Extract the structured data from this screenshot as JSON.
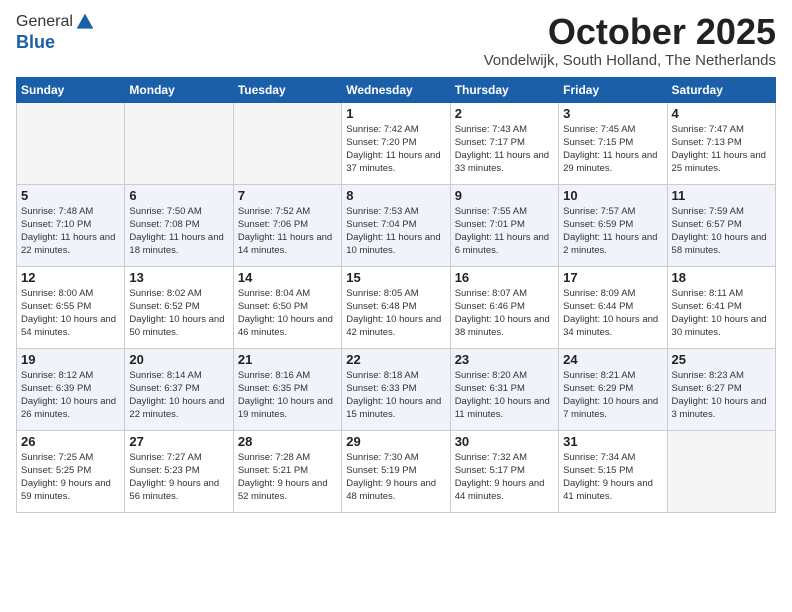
{
  "logo": {
    "general": "General",
    "blue": "Blue"
  },
  "header": {
    "month": "October 2025",
    "location": "Vondelwijk, South Holland, The Netherlands"
  },
  "weekdays": [
    "Sunday",
    "Monday",
    "Tuesday",
    "Wednesday",
    "Thursday",
    "Friday",
    "Saturday"
  ],
  "weeks": [
    [
      {
        "day": "",
        "sunrise": "",
        "sunset": "",
        "daylight": ""
      },
      {
        "day": "",
        "sunrise": "",
        "sunset": "",
        "daylight": ""
      },
      {
        "day": "",
        "sunrise": "",
        "sunset": "",
        "daylight": ""
      },
      {
        "day": "1",
        "sunrise": "Sunrise: 7:42 AM",
        "sunset": "Sunset: 7:20 PM",
        "daylight": "Daylight: 11 hours and 37 minutes."
      },
      {
        "day": "2",
        "sunrise": "Sunrise: 7:43 AM",
        "sunset": "Sunset: 7:17 PM",
        "daylight": "Daylight: 11 hours and 33 minutes."
      },
      {
        "day": "3",
        "sunrise": "Sunrise: 7:45 AM",
        "sunset": "Sunset: 7:15 PM",
        "daylight": "Daylight: 11 hours and 29 minutes."
      },
      {
        "day": "4",
        "sunrise": "Sunrise: 7:47 AM",
        "sunset": "Sunset: 7:13 PM",
        "daylight": "Daylight: 11 hours and 25 minutes."
      }
    ],
    [
      {
        "day": "5",
        "sunrise": "Sunrise: 7:48 AM",
        "sunset": "Sunset: 7:10 PM",
        "daylight": "Daylight: 11 hours and 22 minutes."
      },
      {
        "day": "6",
        "sunrise": "Sunrise: 7:50 AM",
        "sunset": "Sunset: 7:08 PM",
        "daylight": "Daylight: 11 hours and 18 minutes."
      },
      {
        "day": "7",
        "sunrise": "Sunrise: 7:52 AM",
        "sunset": "Sunset: 7:06 PM",
        "daylight": "Daylight: 11 hours and 14 minutes."
      },
      {
        "day": "8",
        "sunrise": "Sunrise: 7:53 AM",
        "sunset": "Sunset: 7:04 PM",
        "daylight": "Daylight: 11 hours and 10 minutes."
      },
      {
        "day": "9",
        "sunrise": "Sunrise: 7:55 AM",
        "sunset": "Sunset: 7:01 PM",
        "daylight": "Daylight: 11 hours and 6 minutes."
      },
      {
        "day": "10",
        "sunrise": "Sunrise: 7:57 AM",
        "sunset": "Sunset: 6:59 PM",
        "daylight": "Daylight: 11 hours and 2 minutes."
      },
      {
        "day": "11",
        "sunrise": "Sunrise: 7:59 AM",
        "sunset": "Sunset: 6:57 PM",
        "daylight": "Daylight: 10 hours and 58 minutes."
      }
    ],
    [
      {
        "day": "12",
        "sunrise": "Sunrise: 8:00 AM",
        "sunset": "Sunset: 6:55 PM",
        "daylight": "Daylight: 10 hours and 54 minutes."
      },
      {
        "day": "13",
        "sunrise": "Sunrise: 8:02 AM",
        "sunset": "Sunset: 6:52 PM",
        "daylight": "Daylight: 10 hours and 50 minutes."
      },
      {
        "day": "14",
        "sunrise": "Sunrise: 8:04 AM",
        "sunset": "Sunset: 6:50 PM",
        "daylight": "Daylight: 10 hours and 46 minutes."
      },
      {
        "day": "15",
        "sunrise": "Sunrise: 8:05 AM",
        "sunset": "Sunset: 6:48 PM",
        "daylight": "Daylight: 10 hours and 42 minutes."
      },
      {
        "day": "16",
        "sunrise": "Sunrise: 8:07 AM",
        "sunset": "Sunset: 6:46 PM",
        "daylight": "Daylight: 10 hours and 38 minutes."
      },
      {
        "day": "17",
        "sunrise": "Sunrise: 8:09 AM",
        "sunset": "Sunset: 6:44 PM",
        "daylight": "Daylight: 10 hours and 34 minutes."
      },
      {
        "day": "18",
        "sunrise": "Sunrise: 8:11 AM",
        "sunset": "Sunset: 6:41 PM",
        "daylight": "Daylight: 10 hours and 30 minutes."
      }
    ],
    [
      {
        "day": "19",
        "sunrise": "Sunrise: 8:12 AM",
        "sunset": "Sunset: 6:39 PM",
        "daylight": "Daylight: 10 hours and 26 minutes."
      },
      {
        "day": "20",
        "sunrise": "Sunrise: 8:14 AM",
        "sunset": "Sunset: 6:37 PM",
        "daylight": "Daylight: 10 hours and 22 minutes."
      },
      {
        "day": "21",
        "sunrise": "Sunrise: 8:16 AM",
        "sunset": "Sunset: 6:35 PM",
        "daylight": "Daylight: 10 hours and 19 minutes."
      },
      {
        "day": "22",
        "sunrise": "Sunrise: 8:18 AM",
        "sunset": "Sunset: 6:33 PM",
        "daylight": "Daylight: 10 hours and 15 minutes."
      },
      {
        "day": "23",
        "sunrise": "Sunrise: 8:20 AM",
        "sunset": "Sunset: 6:31 PM",
        "daylight": "Daylight: 10 hours and 11 minutes."
      },
      {
        "day": "24",
        "sunrise": "Sunrise: 8:21 AM",
        "sunset": "Sunset: 6:29 PM",
        "daylight": "Daylight: 10 hours and 7 minutes."
      },
      {
        "day": "25",
        "sunrise": "Sunrise: 8:23 AM",
        "sunset": "Sunset: 6:27 PM",
        "daylight": "Daylight: 10 hours and 3 minutes."
      }
    ],
    [
      {
        "day": "26",
        "sunrise": "Sunrise: 7:25 AM",
        "sunset": "Sunset: 5:25 PM",
        "daylight": "Daylight: 9 hours and 59 minutes."
      },
      {
        "day": "27",
        "sunrise": "Sunrise: 7:27 AM",
        "sunset": "Sunset: 5:23 PM",
        "daylight": "Daylight: 9 hours and 56 minutes."
      },
      {
        "day": "28",
        "sunrise": "Sunrise: 7:28 AM",
        "sunset": "Sunset: 5:21 PM",
        "daylight": "Daylight: 9 hours and 52 minutes."
      },
      {
        "day": "29",
        "sunrise": "Sunrise: 7:30 AM",
        "sunset": "Sunset: 5:19 PM",
        "daylight": "Daylight: 9 hours and 48 minutes."
      },
      {
        "day": "30",
        "sunrise": "Sunrise: 7:32 AM",
        "sunset": "Sunset: 5:17 PM",
        "daylight": "Daylight: 9 hours and 44 minutes."
      },
      {
        "day": "31",
        "sunrise": "Sunrise: 7:34 AM",
        "sunset": "Sunset: 5:15 PM",
        "daylight": "Daylight: 9 hours and 41 minutes."
      },
      {
        "day": "",
        "sunrise": "",
        "sunset": "",
        "daylight": ""
      }
    ]
  ]
}
